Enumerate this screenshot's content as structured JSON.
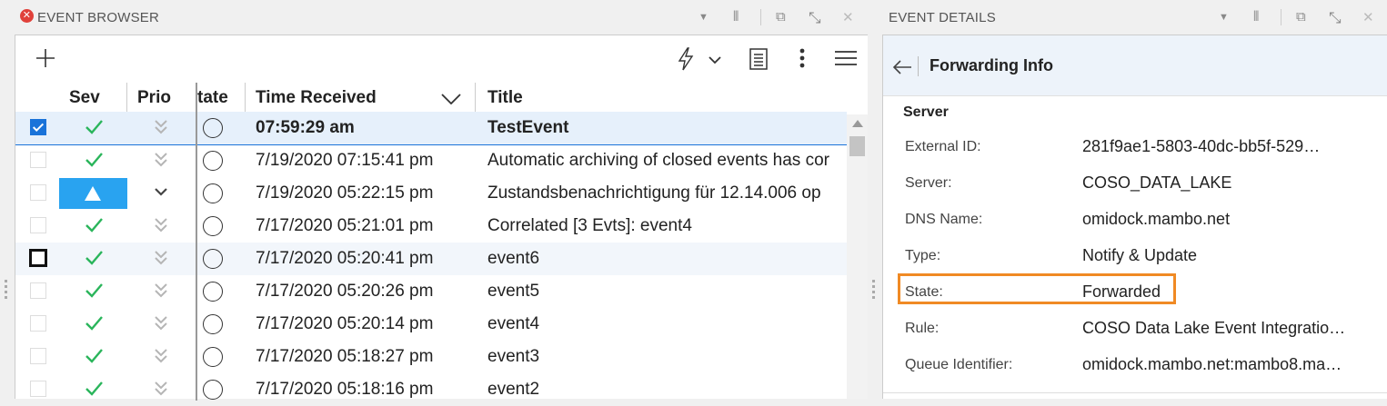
{
  "left_header": {
    "title": "EVENT BROWSER"
  },
  "right_header": {
    "title": "EVENT DETAILS"
  },
  "toolbar": {
    "add_icon": "plus-icon",
    "lightning_icon": "lightning-icon",
    "list_icon": "list-icon",
    "more_icon": "vertical-dots-icon",
    "menu_icon": "hamburger-icon"
  },
  "table": {
    "columns": {
      "sev": "Sev",
      "prio": "Prio",
      "state": "tate",
      "time": "Time Received",
      "title": "Title"
    },
    "rows": [
      {
        "time": "07:59:29 am",
        "title": "TestEvent",
        "sev": "normal",
        "prio": "lowest",
        "checked": true
      },
      {
        "time": "7/19/2020 07:15:41 pm",
        "title": "Automatic archiving of closed events has cor",
        "sev": "normal",
        "prio": "lowest",
        "checked": false
      },
      {
        "time": "7/19/2020 05:22:15 pm",
        "title": "Zustandsbenachrichtigung für 12.14.006 op",
        "sev": "major",
        "prio": "low",
        "checked": false
      },
      {
        "time": "7/17/2020 05:21:01 pm",
        "title": "Correlated [3 Evts]: event4",
        "sev": "normal",
        "prio": "lowest",
        "checked": false
      },
      {
        "time": "7/17/2020 05:20:41 pm",
        "title": "event6",
        "sev": "normal",
        "prio": "lowest",
        "checked": false
      },
      {
        "time": "7/17/2020 05:20:26 pm",
        "title": "event5",
        "sev": "normal",
        "prio": "lowest",
        "checked": false
      },
      {
        "time": "7/17/2020 05:20:14 pm",
        "title": "event4",
        "sev": "normal",
        "prio": "lowest",
        "checked": false
      },
      {
        "time": "7/17/2020 05:18:27 pm",
        "title": "event3",
        "sev": "normal",
        "prio": "lowest",
        "checked": false
      },
      {
        "time": "7/17/2020 05:18:16 pm",
        "title": "event2",
        "sev": "normal",
        "prio": "lowest",
        "checked": false
      }
    ]
  },
  "details": {
    "heading": "Forwarding Info",
    "section": "Server",
    "fields": [
      {
        "label": "External ID:",
        "value": "281f9ae1-5803-40dc-bb5f-529…"
      },
      {
        "label": "Server:",
        "value": "COSO_DATA_LAKE"
      },
      {
        "label": "DNS Name:",
        "value": "omidock.mambo.net"
      },
      {
        "label": "Type:",
        "value": "Notify & Update"
      },
      {
        "label": "State:",
        "value": "Forwarded"
      },
      {
        "label": "Rule:",
        "value": "COSO Data Lake Event Integratio…"
      },
      {
        "label": "Queue Identifier:",
        "value": "omidock.mambo.net:mambo8.ma…"
      }
    ]
  },
  "colors": {
    "accent": "#1a73d9",
    "severity_normal": "#2ab55b",
    "severity_major": "#29a3f0",
    "highlight": "#f08a24",
    "error": "#e0413a"
  }
}
